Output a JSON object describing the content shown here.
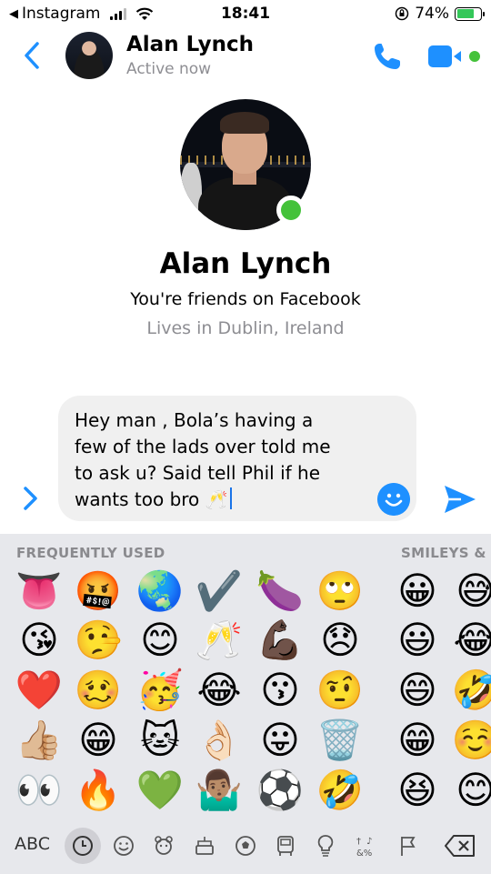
{
  "status_bar": {
    "back_app": "Instagram",
    "time": "18:41",
    "battery_percent": "74%",
    "signal_bars": 3
  },
  "header": {
    "name": "Alan Lynch",
    "status": "Active now",
    "accent_color": "#1e90ff",
    "online_color": "#44c23a"
  },
  "profile": {
    "name": "Alan Lynch",
    "friends_text": "You're friends on Facebook",
    "location_text": "Lives in Dublin, Ireland"
  },
  "composer": {
    "line1": "Hey man , Bola’s having a",
    "line2": "few of the lads over told me",
    "line3": "to ask u? Said tell Phil if he",
    "line4": "wants too bro 🥂"
  },
  "keyboard": {
    "section_frequent": "FREQUENTLY USED",
    "section_smileys": "SMILEYS &",
    "abc_label": "ABC",
    "frequent_rows": [
      [
        "👅",
        "🤬",
        "🌏",
        "✔️",
        "🍆",
        "🙄"
      ],
      [
        "😘",
        "🤥",
        "😊",
        "🥂",
        "💪🏿",
        "😞"
      ],
      [
        "❤️",
        "🥴",
        "🥳",
        "😂",
        "😗",
        "🤨"
      ],
      [
        "👍🏼",
        "😁",
        "🐱",
        "👌🏻",
        "😛",
        "🗑️"
      ],
      [
        "👀",
        "🔥",
        "💚",
        "🤷🏽‍♂️",
        "⚽",
        "🤣"
      ]
    ],
    "smileys_rows": [
      [
        "😀",
        "😅"
      ],
      [
        "😃",
        "😂"
      ],
      [
        "😄",
        "🤣"
      ],
      [
        "😁",
        "☺️"
      ],
      [
        "😆",
        "😊"
      ]
    ],
    "categories": [
      "recent-icon",
      "smiley-icon",
      "animal-icon",
      "food-icon",
      "activity-icon",
      "travel-icon",
      "object-icon",
      "symbol-icon",
      "flag-icon"
    ]
  }
}
